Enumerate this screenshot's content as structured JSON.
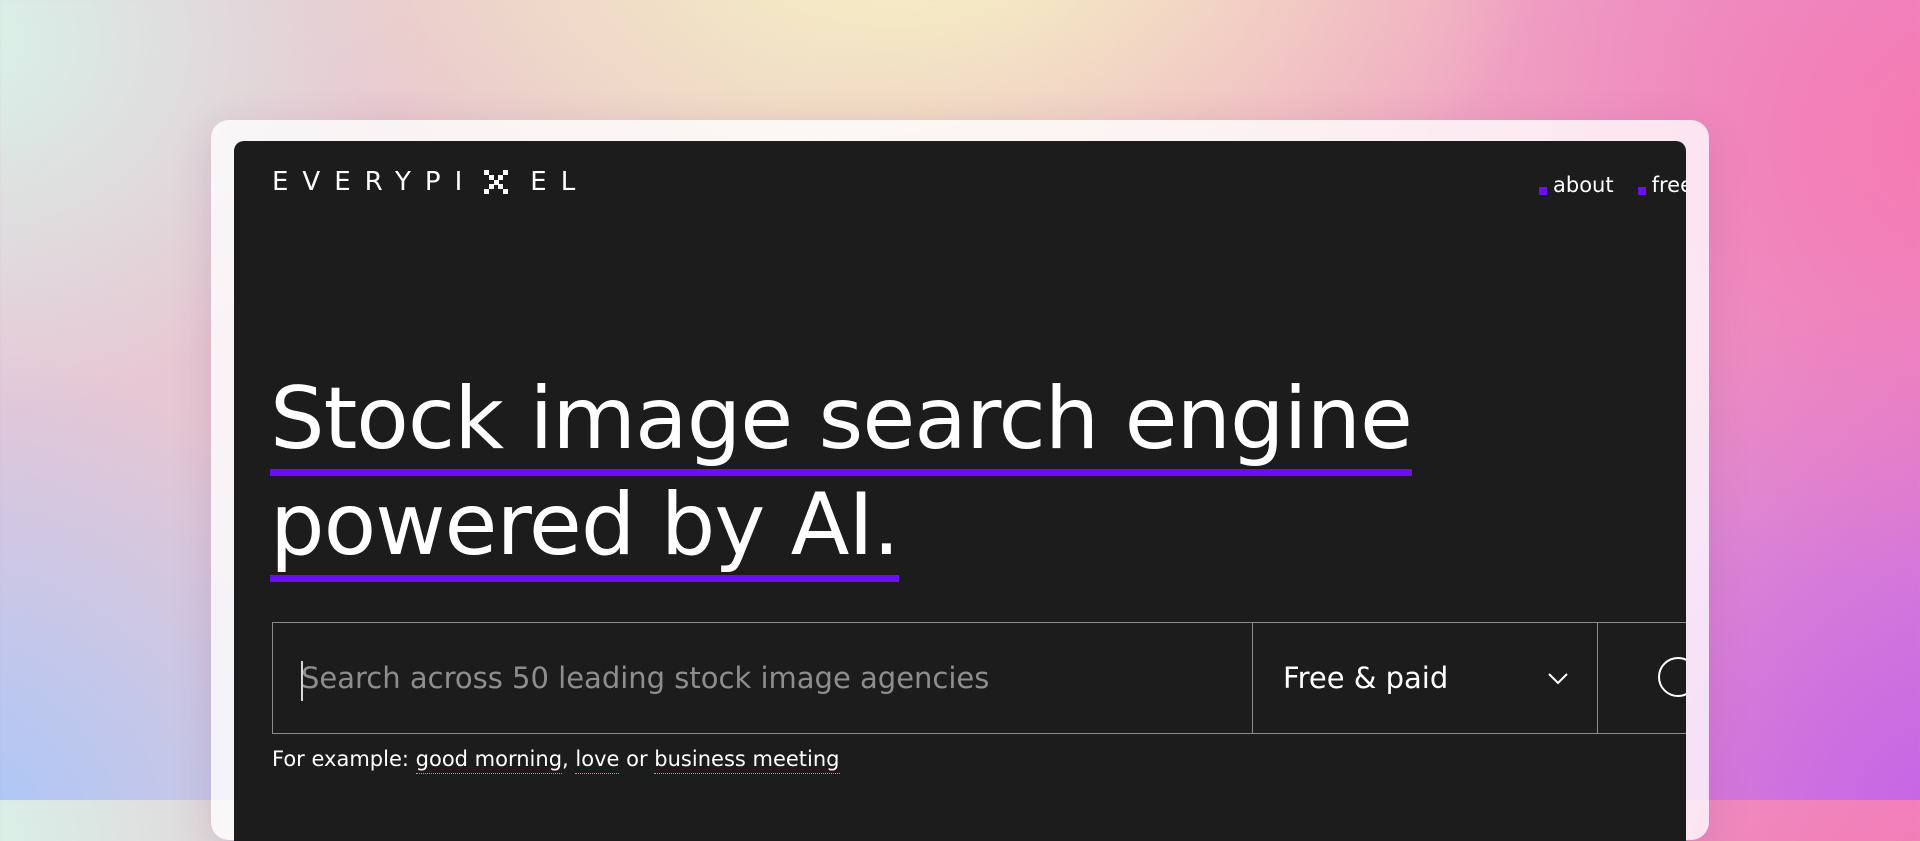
{
  "logo": {
    "text": "EVERYPI",
    "text_after": "EL",
    "icon": "pixel-x-icon"
  },
  "nav": {
    "items": [
      {
        "label": "about"
      },
      {
        "label": "free"
      }
    ]
  },
  "hero": {
    "line1": "Stock image search engine",
    "line2": "powered by AI."
  },
  "search": {
    "placeholder": "Search across 50 leading stock image agencies",
    "value": "",
    "filter": {
      "selected": "Free & paid",
      "icon": "chevron-down-icon"
    },
    "button_icon": "search-icon"
  },
  "examples": {
    "prefix": "For example:",
    "items": [
      "good morning",
      "love",
      "business meeting"
    ],
    "sep1": ",",
    "sep2": "or"
  },
  "colors": {
    "accent": "#6a10f0",
    "screen_bg": "#1c1c1c",
    "text": "#ffffff"
  }
}
